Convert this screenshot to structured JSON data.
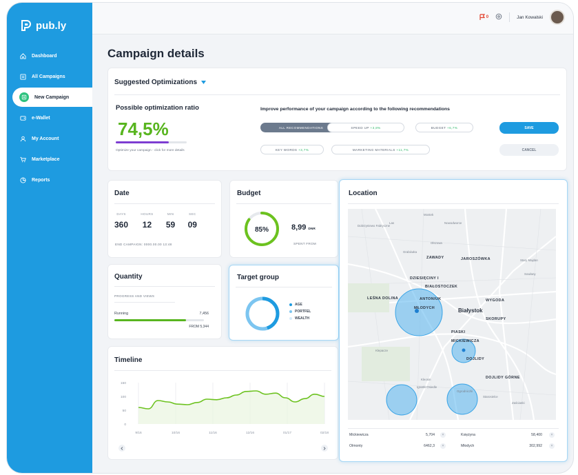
{
  "app": {
    "name": "pub.ly"
  },
  "sidebar": {
    "items": [
      {
        "label": "Dashboard",
        "icon": "home-icon"
      },
      {
        "label": "All Campaigns",
        "icon": "campaigns-icon"
      },
      {
        "label": "New Campaign",
        "icon": "plus-icon",
        "active": true
      },
      {
        "label": "e-Wallet",
        "icon": "wallet-icon"
      },
      {
        "label": "My Account",
        "icon": "user-icon"
      },
      {
        "label": "Marketplace",
        "icon": "cart-icon"
      },
      {
        "label": "Reports",
        "icon": "reports-icon"
      }
    ]
  },
  "header": {
    "user_name": "Jan Kowalski",
    "notification_badge": "0"
  },
  "page": {
    "title": "Campaign details"
  },
  "optimizations": {
    "section_title": "Suggested Optimizations",
    "ratio_title": "Possible optimization ratio",
    "ratio_value": "74,5%",
    "ratio_progress": 0.745,
    "ratio_hint": "Optimize your campaign - click for more details",
    "recommend_title": "Improve performance of your campaign according to the following recommendations",
    "pills": [
      {
        "label": "ALL RECOMMENDATIONS",
        "gain": "",
        "active": true
      },
      {
        "label": "SPEED UP",
        "gain": "+3,8%"
      },
      {
        "label": "BUDGET",
        "gain": "+6,7%"
      },
      {
        "label": "KEY WORDS",
        "gain": "+3,7%"
      },
      {
        "label": "MARKETING MATERIALS",
        "gain": "+11,7%"
      }
    ],
    "save_label": "SAVE",
    "cancel_label": "CANCEL"
  },
  "date_card": {
    "title": "Date",
    "labels": [
      "DAYS",
      "HOURS",
      "MIN",
      "SEC"
    ],
    "values": [
      "360",
      "12",
      "59",
      "09"
    ],
    "end_text": "END CAMPAIGN: 0000.00.00 13:48"
  },
  "budget_card": {
    "title": "Budget",
    "percent": "85%",
    "fraction": 0.85,
    "amount": "8,99",
    "unit": "DNR",
    "spent_label": "SPENT FROM"
  },
  "quantity_card": {
    "title": "Quantity",
    "sub": "PROGRESS AND VIEWS",
    "status": "Running",
    "value": "7,456",
    "from": "FROM 5,344",
    "progress": 0.8
  },
  "target_card": {
    "title": "Target group",
    "legend": [
      {
        "label": "AGE",
        "color": "#1e9be0"
      },
      {
        "label": "PORTFEL",
        "color": "#7cc5f0"
      },
      {
        "label": "WEALTH",
        "color": "#d6ecfa"
      }
    ]
  },
  "timeline_card": {
    "title": "Timeline",
    "chart_data": {
      "type": "line",
      "x_labels": [
        "9/16",
        "10/16",
        "11/16",
        "12/16",
        "01/17",
        "02/18"
      ],
      "y_ticks": [
        "150",
        "100",
        "50",
        "0"
      ],
      "ylim": [
        0,
        150
      ],
      "series": [
        {
          "values": [
            60,
            55,
            85,
            80,
            72,
            70,
            78,
            90,
            88,
            95,
            105,
            118,
            120,
            108,
            112,
            95,
            80,
            92,
            108,
            100
          ]
        }
      ]
    }
  },
  "location_card": {
    "title": "Location",
    "map_labels": [
      "Mostek",
      "Nowodworce",
      "Dobrzyniewo Fabryczne",
      "Olszowa",
      "Las",
      "Grabówka",
      "Zawady",
      "Jaroszówka",
      "Stary Majdan",
      "Sowlany",
      "Dziesięciny I",
      "Białostoczek",
      "Leśna Dolina",
      "Antoniuk",
      "Młodych",
      "Białystok",
      "Wygoda",
      "Skorupy",
      "Piaski",
      "Mickiewicza",
      "Dojlidy",
      "Dojlidy Górne",
      "Klepacze",
      "Kleosin",
      "Ignatki-Osiedle",
      "Ogrodniczki",
      "Starosielce",
      "Zaścianki"
    ],
    "table": [
      {
        "name": "Mickiewicza",
        "value": "5,704",
        "name2": "Księżyna",
        "value2": "58,400"
      },
      {
        "name": "Olmonty",
        "value": "6462,3",
        "name2": "Młodych",
        "value2": "302,992"
      }
    ]
  }
}
